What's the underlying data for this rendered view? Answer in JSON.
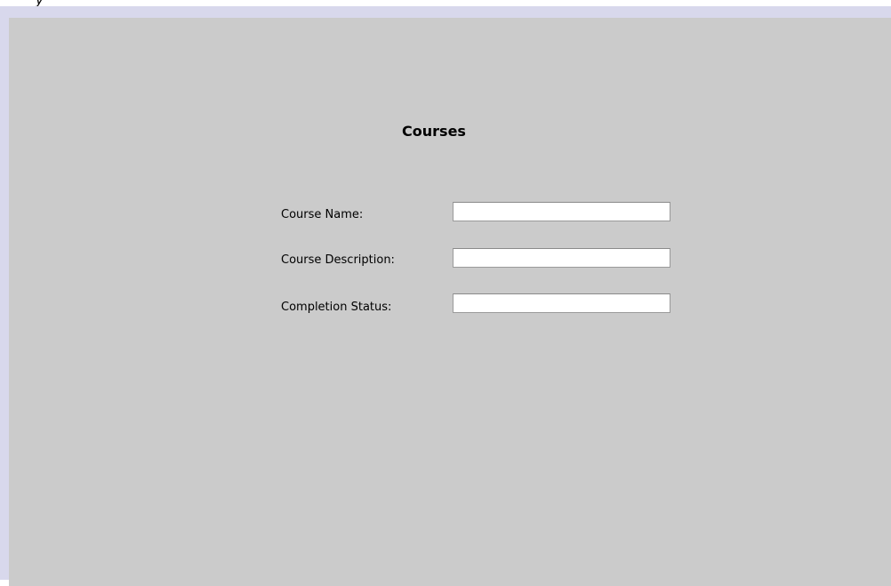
{
  "window": {
    "title_fragment": "y"
  },
  "page": {
    "title": "Courses"
  },
  "form": {
    "fields": [
      {
        "label": "Course Name:",
        "value": "",
        "placeholder": ""
      },
      {
        "label": "Course Description:",
        "value": "",
        "placeholder": ""
      },
      {
        "label": "Completion Status:",
        "value": "",
        "placeholder": ""
      }
    ]
  },
  "colors": {
    "panel_background": "#cbcbcb",
    "frame_border": "#d8d8ec",
    "input_background": "#ffffff"
  }
}
